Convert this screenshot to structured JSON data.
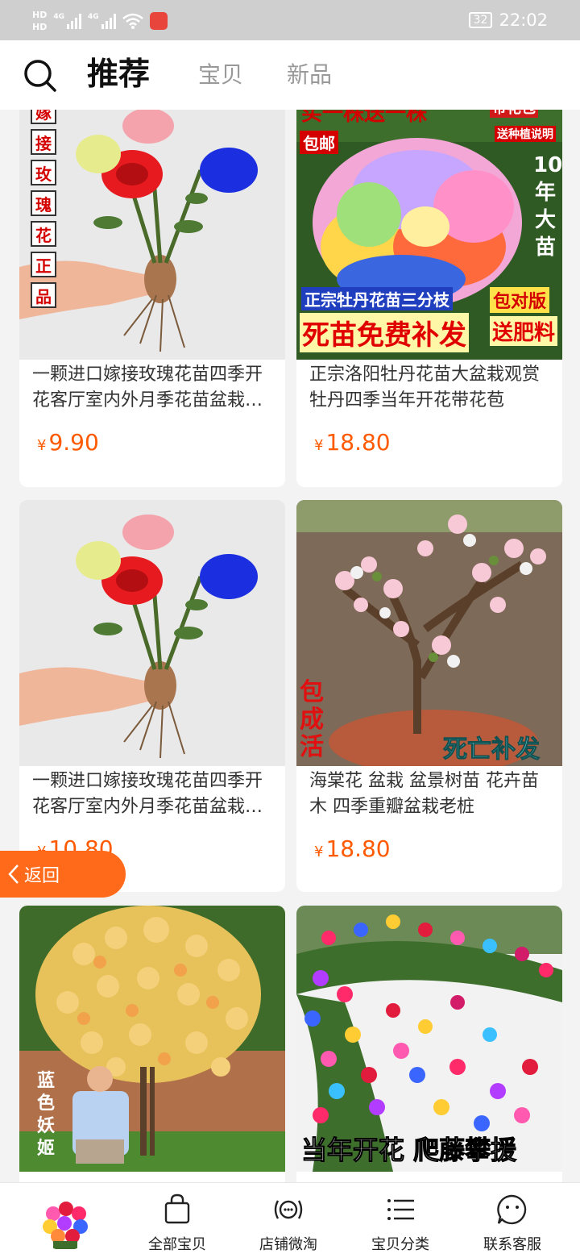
{
  "status_bar": {
    "hd1": "HD",
    "hd2": "HD",
    "net1": "4G",
    "net2": "4G",
    "battery": "32",
    "time": "22:02",
    "icons": [
      "signal-icon",
      "wifi-icon",
      "app-notification-icon",
      "battery-icon"
    ]
  },
  "header": {
    "tabs": [
      {
        "label": "推荐",
        "active": true
      },
      {
        "label": "宝贝",
        "active": false
      },
      {
        "label": "新品",
        "active": false
      }
    ]
  },
  "products": [
    {
      "title": "一颗进口嫁接玫瑰花苗四季开花客厅室内外月季花苗盆栽好养绿植",
      "price": "9.90",
      "image_text": [
        "嫁",
        "接",
        "玫",
        "瑰",
        "花",
        "正",
        "品"
      ]
    },
    {
      "title": "正宗洛阳牡丹花苗大盆栽观赏牡丹四季当年开花带花苞",
      "price": "18.80",
      "image_text": {
        "top": "买一株送一株",
        "top_right": "带花包",
        "free_ship": "包邮",
        "guide": "送种植说明",
        "side": "10年大苗",
        "band": "正宗牡丹花苗三分枝",
        "badge": "包对版",
        "bottom": "死苗免费补发",
        "bottom_right": "送肥料"
      }
    },
    {
      "title": "一颗进口嫁接玫瑰花苗四季开花客厅室内外月季花苗盆栽好养绿植",
      "price": "10.80"
    },
    {
      "title": "海棠花 盆栽 盆景树苗 花卉苗木 四季重瓣盆栽老桩",
      "price": "18.80",
      "image_text": {
        "left": "包成活",
        "bottom_right": "死亡补发"
      }
    },
    {
      "title": "",
      "price": "",
      "image_text": {
        "left": "蓝色妖姬"
      }
    },
    {
      "title": "",
      "price": "",
      "image_text": {
        "bottom": "当年开花 爬藤攀援"
      }
    }
  ],
  "currency": "¥",
  "back_button": {
    "label": "返回"
  },
  "bottom_nav": [
    {
      "label": "全部宝贝",
      "icon": "shopping-bag-icon"
    },
    {
      "label": "店铺微淘",
      "icon": "broadcast-icon"
    },
    {
      "label": "宝贝分类",
      "icon": "list-icon"
    },
    {
      "label": "联系客服",
      "icon": "chat-face-icon"
    }
  ],
  "colors": {
    "accent": "#ff5a00",
    "back_pill": "#ff6a1a"
  }
}
